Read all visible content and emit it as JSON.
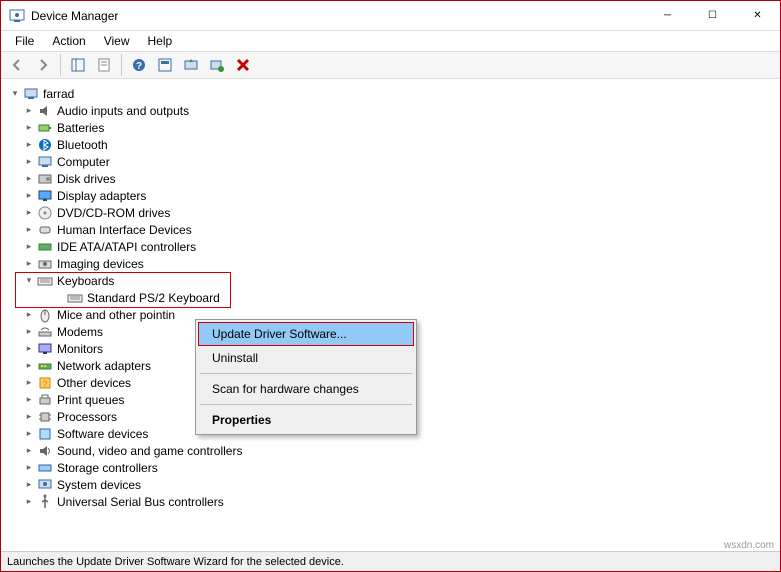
{
  "window": {
    "title": "Device Manager"
  },
  "menu": {
    "file": "File",
    "action": "Action",
    "view": "View",
    "help": "Help"
  },
  "tree": {
    "root": "farrad",
    "items": [
      "Audio inputs and outputs",
      "Batteries",
      "Bluetooth",
      "Computer",
      "Disk drives",
      "Display adapters",
      "DVD/CD-ROM drives",
      "Human Interface Devices",
      "IDE ATA/ATAPI controllers",
      "Imaging devices",
      "Keyboards",
      "Mice and other pointin",
      "Modems",
      "Monitors",
      "Network adapters",
      "Other devices",
      "Print queues",
      "Processors",
      "Software devices",
      "Sound, video and game controllers",
      "Storage controllers",
      "System devices",
      "Universal Serial Bus controllers"
    ],
    "keyboard_child": "Standard PS/2 Keyboard"
  },
  "context_menu": {
    "update": "Update Driver Software...",
    "uninstall": "Uninstall",
    "scan": "Scan for hardware changes",
    "properties": "Properties"
  },
  "status": "Launches the Update Driver Software Wizard for the selected device.",
  "watermark": "wsxdn.com"
}
